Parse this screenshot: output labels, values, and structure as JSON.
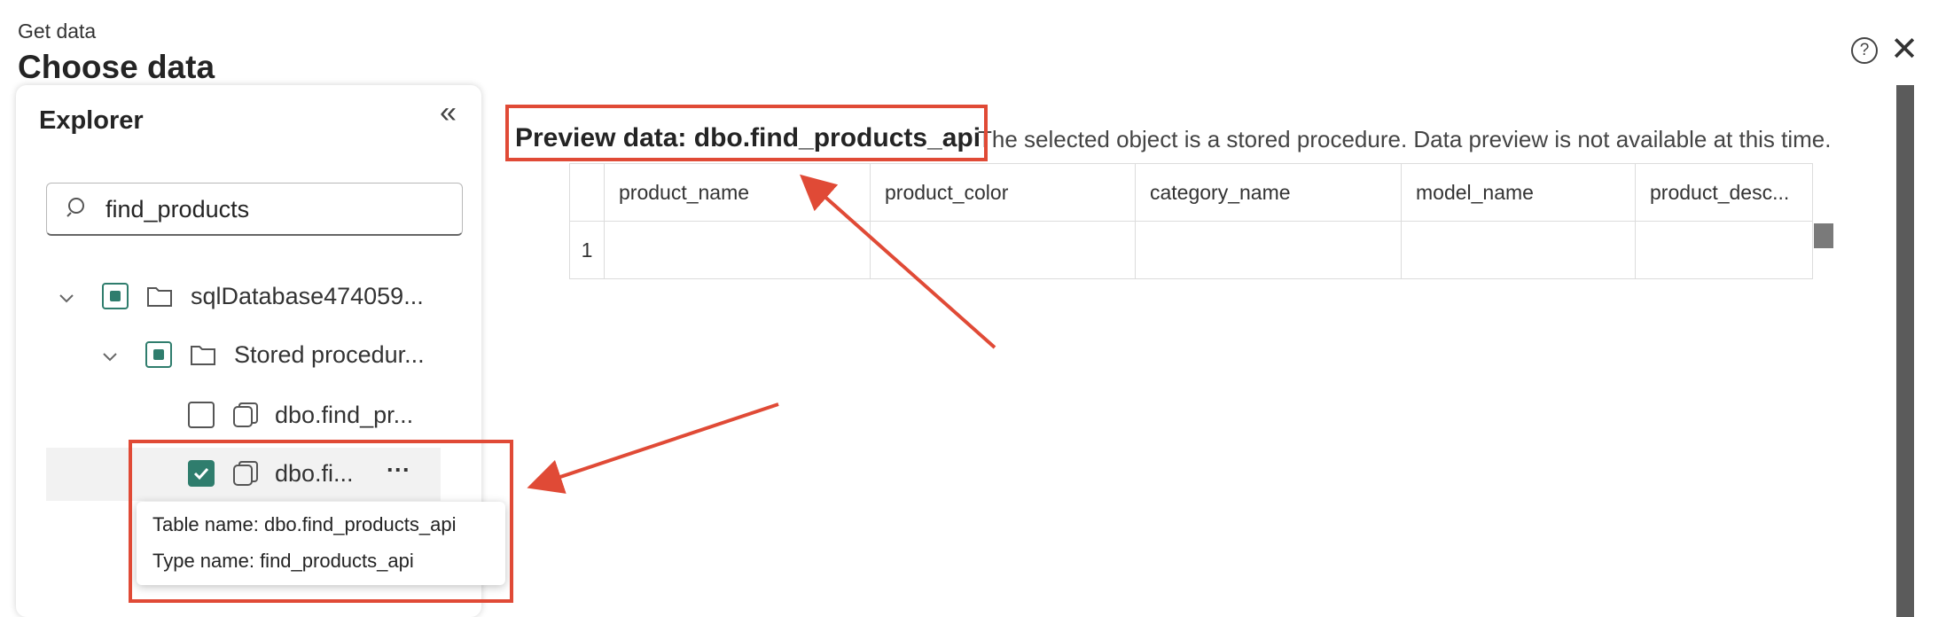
{
  "header": {
    "subtitle": "Get data",
    "title": "Choose data"
  },
  "explorer": {
    "title": "Explorer",
    "search": {
      "value": "find_products",
      "placeholder": ""
    },
    "tree": {
      "database": "sqlDatabase474059...",
      "folder": "Stored procedur...",
      "item1": "dbo.find_pr...",
      "item2": "dbo.fi...",
      "more": "···"
    },
    "tooltip": {
      "table_name": "Table name: dbo.find_products_api",
      "type_name": "Type name: find_products_api"
    }
  },
  "preview": {
    "title": "Preview data: dbo.find_products_api",
    "message": "The selected object is a stored procedure. Data preview is not available at this time.",
    "columns": [
      "product_name",
      "product_color",
      "category_name",
      "model_name",
      "product_desc..."
    ],
    "row_number": "1"
  },
  "colors": {
    "accent": "#2f7d6d",
    "annotation": "#e04a36"
  }
}
